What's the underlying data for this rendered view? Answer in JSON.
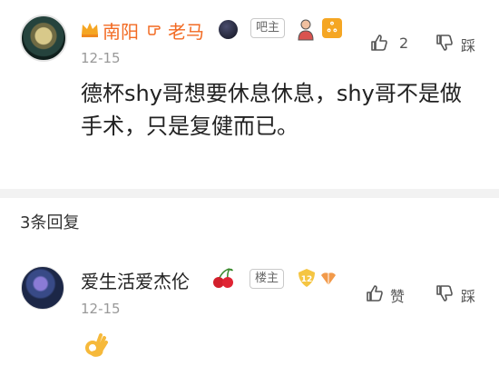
{
  "top_comment": {
    "username_part1": "南阳",
    "username_part2": "老马",
    "badge": "吧主",
    "level": "ஃ",
    "date": "12-15",
    "like_count": "2",
    "dislike_label": "踩",
    "text": "德杯shy哥想要休息休息，shy哥不是做手术，只是复健而已。"
  },
  "replies": {
    "header": "3条回复",
    "items": [
      {
        "username": "爱生活爱杰伦",
        "badge": "楼主",
        "level": "12",
        "date": "12-15",
        "like_label": "赞",
        "dislike_label": "踩",
        "text": "👌"
      }
    ]
  },
  "colors": {
    "username_accent": "#f26a22",
    "level_badge": "#f5a623",
    "section_gap": "#f2f2f2",
    "meta_gray": "#999999"
  }
}
